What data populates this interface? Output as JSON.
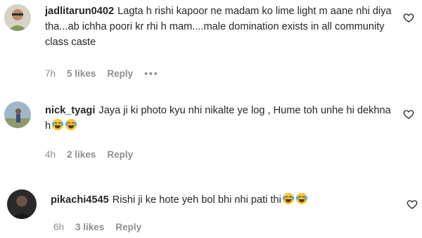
{
  "comments": [
    {
      "username": "jadlitarun0402",
      "text": "Lagta h rishi kapoor ne madam ko lime light m aane nhi diya tha...ab ichha poori kr rhi h mam....male domination exists in all community class caste",
      "emojis": [],
      "time": "7h",
      "likes": "5 likes",
      "reply": "Reply",
      "more": "•••",
      "avatar": "avatar-icon",
      "like_icon": "heart-outline-icon"
    },
    {
      "username": "nick_tyagi",
      "text": "Jaya ji ki photo kyu nhi nikalte ye log , Hume toh unhe hi dekhna h",
      "emojis": [
        "laughing-tears-emoji",
        "laughing-tears-emoji"
      ],
      "time": "4h",
      "likes": "2 likes",
      "reply": "Reply",
      "avatar": "avatar-icon",
      "like_icon": "heart-outline-icon"
    },
    {
      "username": "pikachi4545",
      "text": "Rishi ji ke hote yeh bol bhi nhi pati thi",
      "emojis": [
        "laughing-tears-emoji",
        "laughing-tears-emoji"
      ],
      "time": "6h",
      "likes": "3 likes",
      "reply": "Reply",
      "avatar": "avatar-icon",
      "like_icon": "heart-outline-icon"
    }
  ]
}
